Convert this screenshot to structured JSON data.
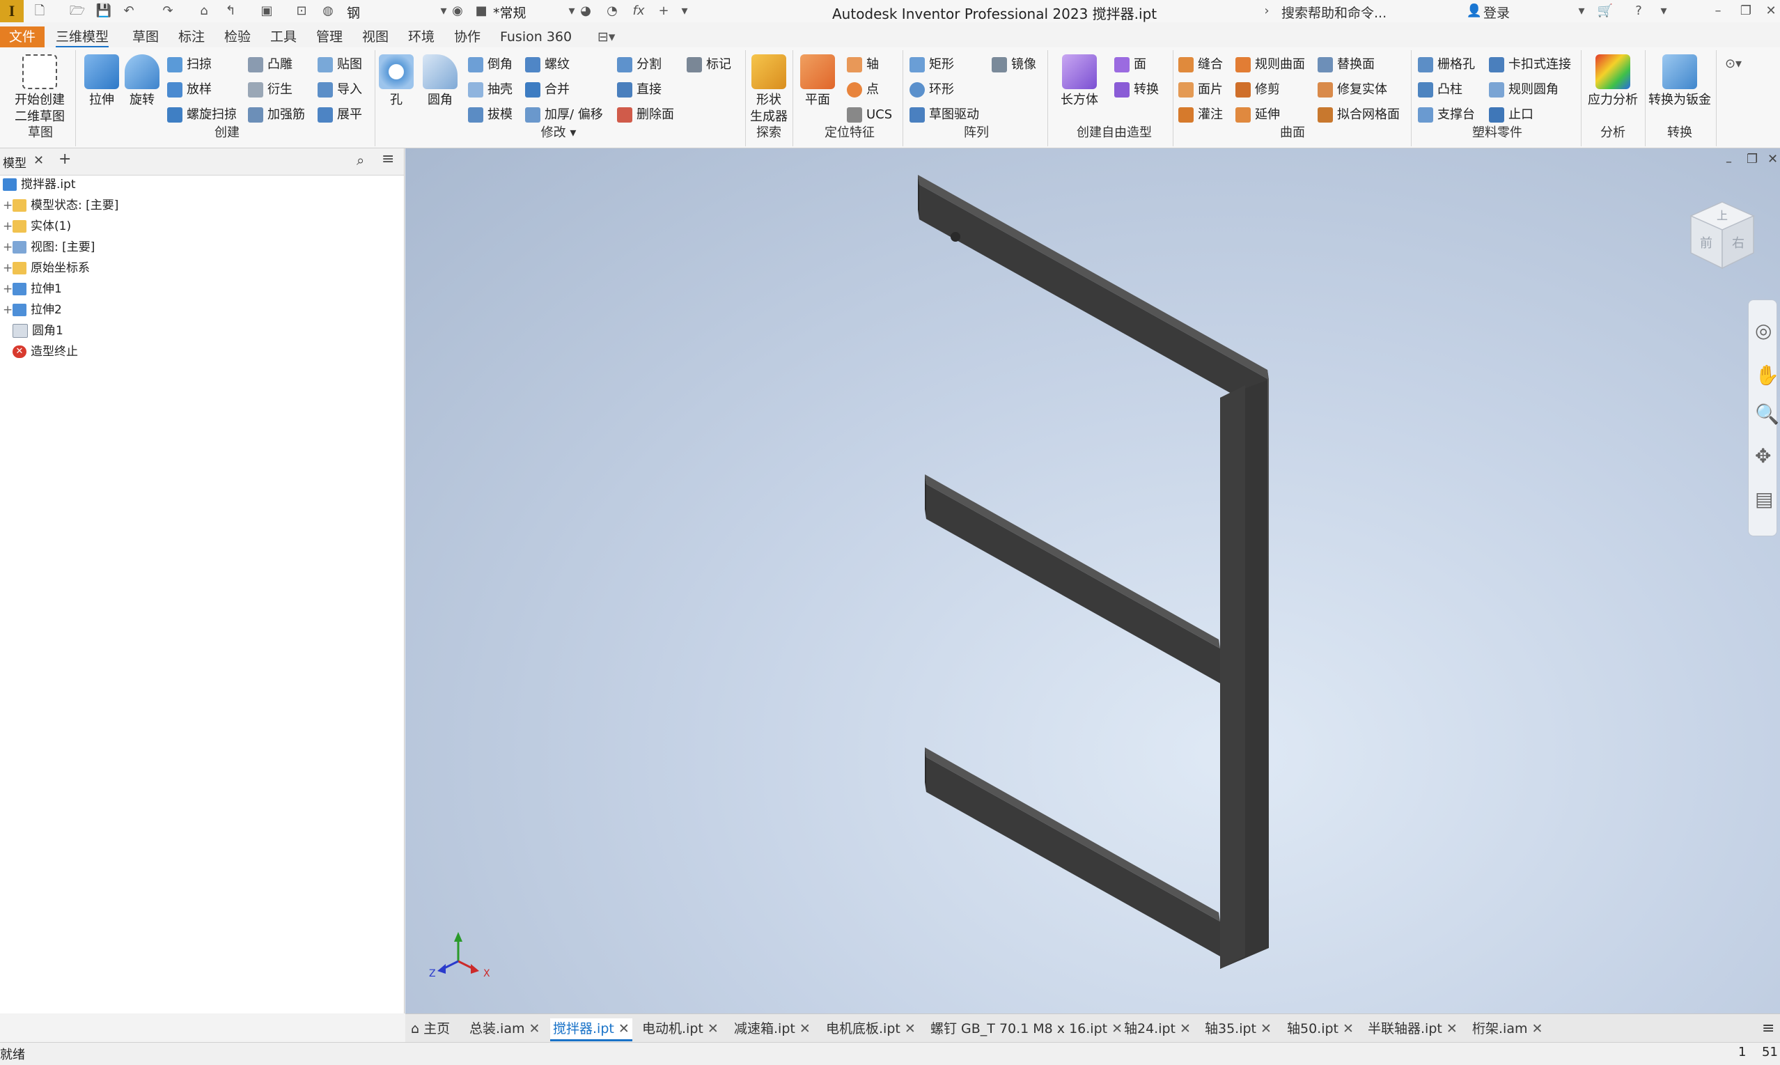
{
  "title_bar": {
    "app_logo": "I",
    "material": "钢",
    "appearance": "*常规",
    "app_title": "Autodesk Inventor Professional 2023   搅拌器.ipt",
    "search_help": "搜索帮助和命令...",
    "login": "登录"
  },
  "ribbon_tabs": [
    "文件",
    "三维模型",
    "草图",
    "标注",
    "检验",
    "工具",
    "管理",
    "视图",
    "环境",
    "协作",
    "Fusion 360"
  ],
  "ribbon": {
    "sketch": {
      "start_sketch": "开始创建",
      "start_sketch2": "二维草图",
      "group": "草图"
    },
    "create": {
      "extrude": "拉伸",
      "revolve": "旋转",
      "sweep": "扫掠",
      "loft": "放样",
      "coil": "螺旋扫掠",
      "emboss": "凸雕",
      "derive": "衍生",
      "rib": "加强筋",
      "decal": "贴图",
      "import": "导入",
      "unwrap": "展平",
      "group": "创建"
    },
    "modify": {
      "hole": "孔",
      "fillet": "圆角",
      "chamfer": "倒角",
      "shell": "抽壳",
      "draft": "拔模",
      "thread": "螺纹",
      "combine": "合并",
      "thicken": "加厚/ 偏移",
      "split": "分割",
      "direct": "直接",
      "delete_face": "删除面",
      "mark": "标记",
      "group": "修改"
    },
    "explore": {
      "shape_gen": "形状",
      "shape_gen2": "生成器",
      "group": "探索"
    },
    "work_features": {
      "plane": "平面",
      "axis": "轴",
      "point": "点",
      "ucs": "UCS",
      "group": "定位特征"
    },
    "pattern": {
      "rect": "矩形",
      "circ": "环形",
      "sketch_driven": "草图驱动",
      "mirror": "镜像",
      "group": "阵列"
    },
    "freeform": {
      "box": "长方体",
      "face": "面",
      "convert": "转换",
      "group": "创建自由造型"
    },
    "surface": {
      "stitch": "缝合",
      "patch": "面片",
      "sculpt": "灌注",
      "ruled": "规则曲面",
      "trim": "修剪",
      "extend": "延伸",
      "replace": "替换面",
      "repair": "修复实体",
      "fit_mesh": "拟合网格面",
      "group": "曲面"
    },
    "plastic": {
      "grill": "栅格孔",
      "boss": "凸柱",
      "rest": "支撑台",
      "snap": "卡扣式连接",
      "rule_fillet": "规则圆角",
      "lip": "止口",
      "group": "塑料零件"
    },
    "analysis": {
      "stress": "应力分析",
      "group": "分析"
    },
    "convert": {
      "to_sheet": "转换为钣金",
      "group": "转换"
    }
  },
  "browser": {
    "tab_label": "模型",
    "items": [
      {
        "label": "搅拌器.ipt"
      },
      {
        "label": "模型状态: [主要]"
      },
      {
        "label": "实体(1)"
      },
      {
        "label": "视图: [主要]"
      },
      {
        "label": "原始坐标系"
      },
      {
        "label": "拉伸1"
      },
      {
        "label": "拉伸2"
      },
      {
        "label": "圆角1"
      },
      {
        "label": "造型终止"
      }
    ]
  },
  "viewcube": {
    "top": "上",
    "front": "前",
    "right": "右"
  },
  "triad": {
    "x": "X",
    "y": "Y",
    "z": "Z"
  },
  "document_tabs": [
    {
      "label": "主页"
    },
    {
      "label": "总装.iam"
    },
    {
      "label": "搅拌器.ipt",
      "active": true
    },
    {
      "label": "电动机.ipt"
    },
    {
      "label": "减速箱.ipt"
    },
    {
      "label": "电机底板.ipt"
    },
    {
      "label": "螺钉 GB_T 70.1 M8 x 16.ipt"
    },
    {
      "label": "轴24.ipt"
    },
    {
      "label": "轴35.ipt"
    },
    {
      "label": "轴50.ipt"
    },
    {
      "label": "半联轴器.ipt"
    },
    {
      "label": "桁架.iam"
    }
  ],
  "status": {
    "text": "就绪",
    "count1": "1",
    "count2": "51"
  },
  "colors": {
    "file_tab": "#e67e22",
    "active_doc_tab": "#1a73c8",
    "part_color": "#3a3a3a"
  }
}
